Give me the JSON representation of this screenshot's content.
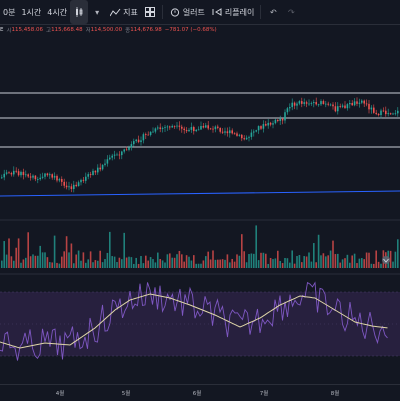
{
  "toolbar": {
    "interval_partial": "0분",
    "interval_1h": "1시간",
    "interval_4h": "4시간",
    "indicators_label": "지표",
    "alert_label": "얼러트",
    "replay_label": "리플레이"
  },
  "legend": {
    "symbol_partial": "E",
    "open_key": "시",
    "open_value": "115,458.06",
    "high_key": "고",
    "high_value": "115,668.48",
    "low_key": "저",
    "low_value": "114,500.00",
    "close_key": "종",
    "close_value": "114,676.98",
    "change_value": "−781.07 (−0.68%)"
  },
  "colors": {
    "background": "#131722",
    "up": "#26a69a",
    "down": "#ef5350",
    "level_line": "#c8ccd6",
    "trend_line": "#2962ff",
    "oscillator_fast": "#7e57c2",
    "oscillator_slow": "#e0d7a8",
    "oscillator_band": "#2a2141"
  },
  "x_axis": [
    "4월",
    "5월",
    "6월",
    "7월",
    "8월"
  ],
  "chart_data": {
    "type": "candlestick",
    "price_series": "daily close approximation, upward trend Mar–Aug",
    "horizontal_levels": 3,
    "trend_line": "slightly rising blue line",
    "panes": [
      "price",
      "volume",
      "oscillator"
    ]
  }
}
